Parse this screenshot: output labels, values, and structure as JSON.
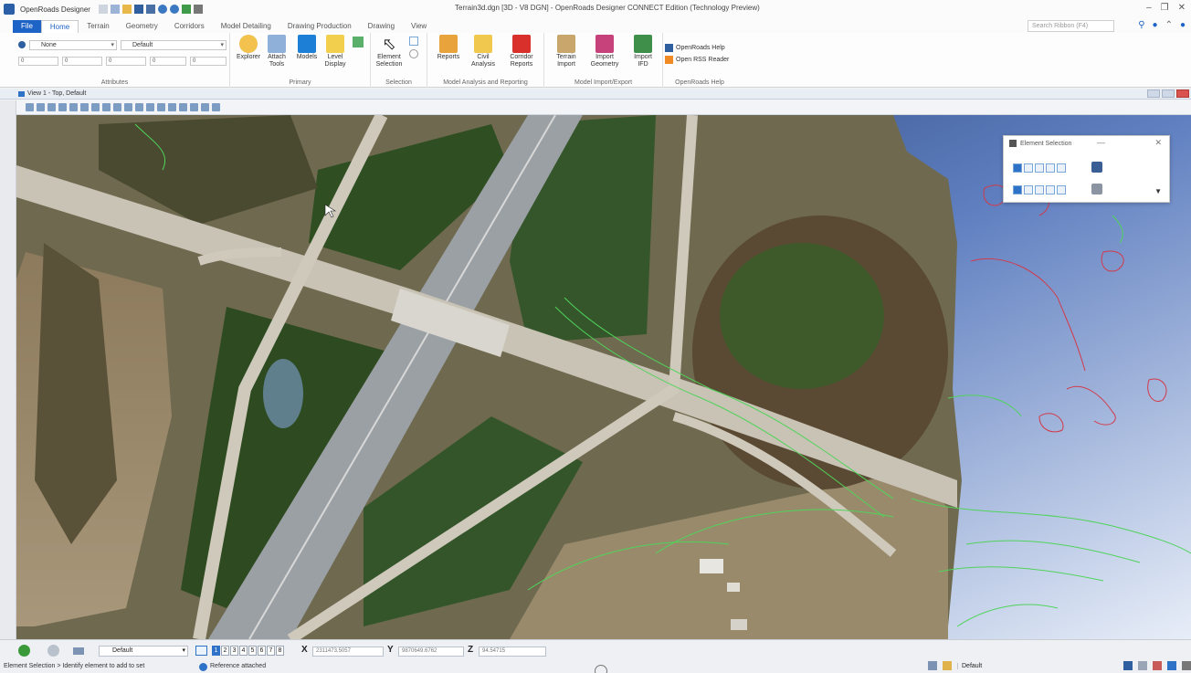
{
  "titlebar": {
    "app_name": "OpenRoads Designer",
    "title": "Terrain3d.dgn [3D - V8 DGN] - OpenRoads Designer CONNECT Edition (Technology Preview)",
    "minimize_glyph": "–",
    "restore_glyph": "❐",
    "close_glyph": "✕"
  },
  "ribbon_tabs": [
    "File",
    "Home",
    "Terrain",
    "Geometry",
    "Corridors",
    "Model Detailing",
    "Drawing Production",
    "Drawing",
    "View"
  ],
  "active_tab": "Home",
  "search": {
    "placeholder": "Search Ribbon (F4)"
  },
  "attributes": {
    "level_value": "None",
    "style_value": "Default",
    "color_value": "0",
    "linestyle_value": "0",
    "weight_value": "0",
    "transparency_value": "0",
    "priority_value": "0",
    "label": "Attributes"
  },
  "primary": {
    "label": "Primary",
    "buttons": [
      "Explorer",
      "Attach Tools",
      "Models",
      "Level Display"
    ]
  },
  "selection": {
    "label": "Selection",
    "buttons": [
      "Element Selection"
    ]
  },
  "model_analysis": {
    "label": "Model Analysis and Reporting",
    "buttons": [
      "Reports",
      "Civil Analysis",
      "Corridor Reports"
    ]
  },
  "model_import": {
    "label": "Model Import/Export",
    "buttons": [
      "Terrain Import",
      "Import Geometry",
      "Import IFD"
    ]
  },
  "help": {
    "label": "OpenRoads Help",
    "items": [
      "OpenRoads Help",
      "Open RSS Reader"
    ]
  },
  "view": {
    "title": "View 1 - Top, Default"
  },
  "element_selection_dialog": {
    "title": "Element Selection",
    "minimize_glyph": "—",
    "close_glyph": "✕"
  },
  "statusbar": {
    "active_level": "Default",
    "view_numbers": [
      "1",
      "2",
      "3",
      "4",
      "5",
      "6",
      "7",
      "8"
    ],
    "active_view_index": 0,
    "x_label": "X",
    "x_value": "2311473.5057",
    "y_label": "Y",
    "y_value": "9870649.6762",
    "z_label": "Z",
    "z_value": "94.54715",
    "prompt": "Element Selection > Identify element to add to set",
    "message": "Reference attached",
    "level_display": "Default"
  }
}
